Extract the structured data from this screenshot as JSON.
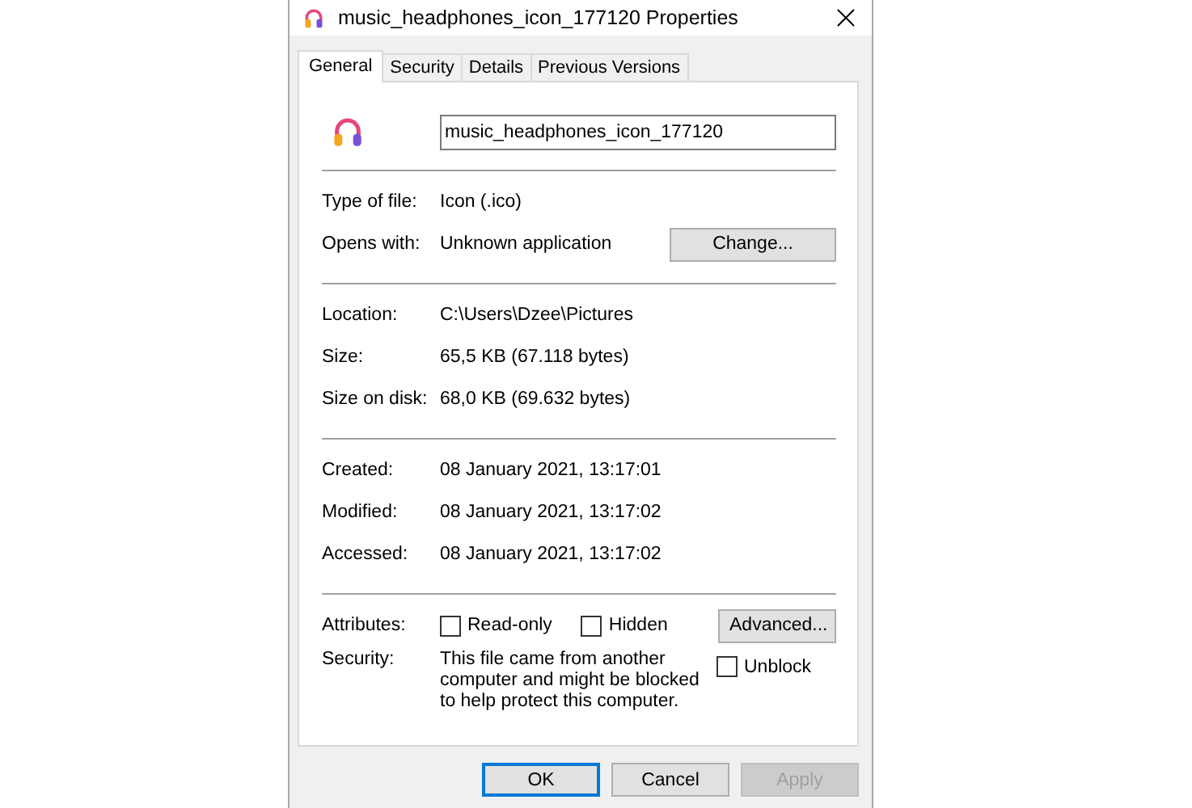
{
  "window": {
    "title": "music_headphones_icon_177120 Properties"
  },
  "tabs": [
    {
      "label": "General",
      "selected": true
    },
    {
      "label": "Security",
      "selected": false
    },
    {
      "label": "Details",
      "selected": false
    },
    {
      "label": "Previous Versions",
      "selected": false
    }
  ],
  "file_name": "music_headphones_icon_177120",
  "sections": [
    [
      {
        "kind": "text",
        "label": "Type of file:",
        "value": "Icon (.ico)"
      },
      {
        "kind": "button",
        "label": "Opens with:",
        "value": "Unknown application",
        "button": "Change..."
      }
    ],
    [
      {
        "kind": "text",
        "label": "Location:",
        "value": "C:\\Users\\Dzee\\Pictures"
      },
      {
        "kind": "text",
        "label": "Size:",
        "value": "65,5 KB (67.118 bytes)"
      },
      {
        "kind": "text",
        "label": "Size on disk:",
        "value": "68,0 KB (69.632 bytes)"
      }
    ],
    [
      {
        "kind": "text",
        "label": "Created:",
        "value": "08 January 2021, 13:17:01"
      },
      {
        "kind": "text",
        "label": "Modified:",
        "value": "08 January 2021, 13:17:02"
      },
      {
        "kind": "text",
        "label": "Accessed:",
        "value": "08 January 2021, 13:17:02"
      }
    ],
    [
      {
        "kind": "attributes",
        "label": "Attributes:",
        "checkboxes": [
          {
            "label": "Read-only",
            "checked": false
          },
          {
            "label": "Hidden",
            "checked": false
          }
        ],
        "button": "Advanced..."
      },
      {
        "kind": "security",
        "label": "Security:",
        "text": "This file came from another computer and might be blocked to help protect this computer.",
        "checkbox": {
          "label": "Unblock",
          "checked": false
        }
      }
    ]
  ],
  "buttons": [
    {
      "label": "OK",
      "default": true,
      "disabled": false
    },
    {
      "label": "Cancel",
      "default": false,
      "disabled": false
    },
    {
      "label": "Apply",
      "default": false,
      "disabled": true
    }
  ]
}
